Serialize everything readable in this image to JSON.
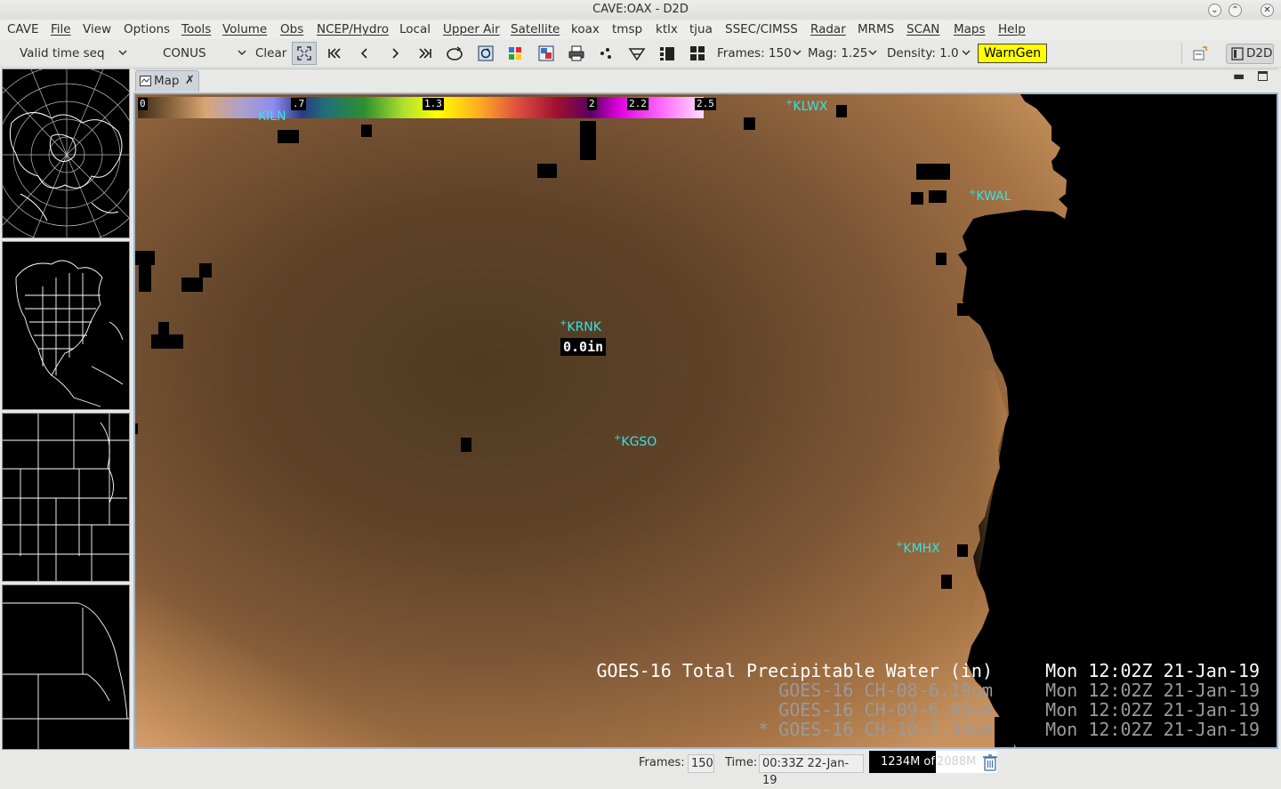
{
  "window": {
    "title": "CAVE:OAX - D2D"
  },
  "menubar": {
    "items": [
      {
        "label": "CAVE"
      },
      {
        "label": "File"
      },
      {
        "label": "View"
      },
      {
        "label": "Options"
      },
      {
        "label": "Tools"
      },
      {
        "label": "Volume"
      },
      {
        "label": "Obs"
      },
      {
        "label": "NCEP/Hydro"
      },
      {
        "label": "Local"
      },
      {
        "label": "Upper Air"
      },
      {
        "label": "Satellite"
      },
      {
        "label": "koax"
      },
      {
        "label": "tmsp"
      },
      {
        "label": "ktlx"
      },
      {
        "label": "tjua"
      },
      {
        "label": "SSEC/CIMSS"
      },
      {
        "label": "Radar"
      },
      {
        "label": "MRMS"
      },
      {
        "label": "SCAN"
      },
      {
        "label": "Maps"
      },
      {
        "label": "Help"
      }
    ]
  },
  "toolbar": {
    "time_mode": "Valid time seq",
    "scale": "CONUS",
    "clear_label": "Clear",
    "frames_label": "Frames: 150",
    "mag_label": "Mag: 1.25",
    "density_label": "Density: 1.0",
    "warngen_label": "WarnGen",
    "perspective_label": "D2D"
  },
  "map": {
    "tab_label": "Map",
    "colorbar": {
      "labels": [
        "0",
        ".7",
        "1.3",
        "2",
        "2.2",
        "2.5"
      ],
      "min": 0,
      "max": 2.5
    },
    "stations": [
      {
        "id": "KILN",
        "label": "KILN"
      },
      {
        "id": "KLWX",
        "label": "KLWX"
      },
      {
        "id": "KWAL",
        "label": "KWAL"
      },
      {
        "id": "KRNK",
        "label": "KRNK"
      },
      {
        "id": "KGSO",
        "label": "KGSO"
      },
      {
        "id": "KMHX",
        "label": "KMHX"
      }
    ],
    "sample_readout": "0.0in",
    "legend": [
      {
        "marker": "",
        "product": "GOES-16 Total Precipitable Water (in)",
        "time": "Mon 12:02Z 21-Jan-19",
        "style": "main"
      },
      {
        "marker": "",
        "product": "GOES-16 CH-08-6.19um",
        "time": "Mon 12:02Z 21-Jan-19",
        "style": "dim"
      },
      {
        "marker": "",
        "product": "GOES-16 CH-09-6.95um",
        "time": "Mon 12:02Z 21-Jan-19",
        "style": "dim"
      },
      {
        "marker": "*",
        "product": "GOES-16 CH-10-7.34um",
        "time": "Mon 12:02Z 21-Jan-19",
        "style": "dim"
      }
    ]
  },
  "statusbar": {
    "frames_label": "Frames:",
    "frames_value": "150",
    "time_label": "Time:",
    "time_value": "00:33Z 22-Jan-19",
    "memory_used": "1234M of",
    "memory_total": "2088M"
  },
  "colors": {
    "warngen_bg": "#ffff00",
    "station_label": "#34e3e3",
    "tab_bg": "#cfd4dc",
    "map_brown_dark": "#5a4128",
    "map_brown_light": "#c7925e"
  }
}
